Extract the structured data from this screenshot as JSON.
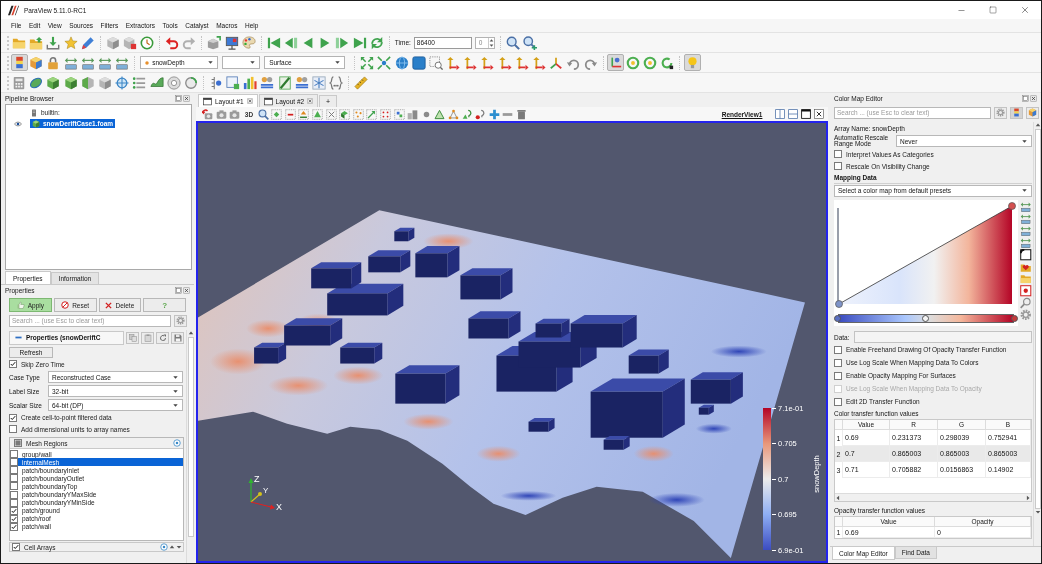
{
  "window": {
    "title": "ParaView 5.11.0-RC1"
  },
  "menu": [
    "File",
    "Edit",
    "View",
    "Sources",
    "Filters",
    "Extractors",
    "Tools",
    "Catalyst",
    "Macros",
    "Help"
  ],
  "time": {
    "label": "Time:",
    "value": "86400",
    "index": "0"
  },
  "toggles": {
    "color_bar": {
      "on": true
    },
    "axes": {
      "on": true
    },
    "lightbulb": {
      "on": true
    }
  },
  "variables": {
    "array": "snowDepth",
    "representation": "Surface"
  },
  "pipeline_browser": {
    "title": "Pipeline Browser",
    "items": [
      {
        "label": "builtin:",
        "selected": false,
        "children": [
          {
            "label": "snowDeriftCase1.foam",
            "selected": true,
            "visible": true
          }
        ]
      }
    ]
  },
  "left_tabs": [
    {
      "label": "Properties",
      "selected": true
    },
    {
      "label": "Information",
      "selected": false
    }
  ],
  "properties": {
    "title": "Properties",
    "buttons": [
      {
        "kind": "apply",
        "label": "Apply"
      },
      {
        "kind": "reset",
        "label": "Reset"
      },
      {
        "kind": "delete",
        "label": "Delete"
      },
      {
        "kind": "help",
        "label": "?"
      }
    ],
    "search": {
      "placeholder": "Search ... (use Esc to clear text)"
    },
    "section_title": "Properties (snowDeriftC",
    "refresh": "Refresh",
    "skip_zero_time": {
      "label": "Skip Zero Time",
      "checked": true
    },
    "fields": [
      {
        "label": "Case Type",
        "value": "Reconstructed Case"
      },
      {
        "label": "Label Size",
        "value": "32-bit"
      },
      {
        "label": "Scalar Size",
        "value": "64-bit (DP)"
      }
    ],
    "options": [
      {
        "label": "Create cell-to-point filtered data",
        "checked": true
      },
      {
        "label": "Add dimensional units to array names",
        "checked": false
      }
    ],
    "mesh_regions": {
      "title": "Mesh Regions",
      "checked": false,
      "partial": true,
      "items": [
        {
          "label": "group/wall",
          "checked": false,
          "selected": false
        },
        {
          "label": "internalMesh",
          "checked": false,
          "selected": true
        },
        {
          "label": "patch/boundaryInlet",
          "checked": false,
          "selected": false
        },
        {
          "label": "patch/boundaryOutlet",
          "checked": false,
          "selected": false
        },
        {
          "label": "patch/boundaryTop",
          "checked": false,
          "selected": false
        },
        {
          "label": "patch/boundaryYMaxSide",
          "checked": false,
          "selected": false
        },
        {
          "label": "patch/boundaryYMinSide",
          "checked": false,
          "selected": false
        },
        {
          "label": "patch/ground",
          "checked": true,
          "selected": false
        },
        {
          "label": "patch/roof",
          "checked": true,
          "selected": false
        },
        {
          "label": "patch/wall",
          "checked": true,
          "selected": false
        }
      ]
    },
    "cell_arrays": {
      "title": "Cell Arrays",
      "checked": true
    }
  },
  "layout_tabs": [
    {
      "label": "Layout #1",
      "selected": true
    },
    {
      "label": "Layout #2",
      "selected": false
    }
  ],
  "new_tab": "+",
  "view_toolbar": {
    "mode": "3D",
    "view_name": "RenderView1"
  },
  "render_view": {
    "axes": [
      {
        "label": "Z"
      },
      {
        "label": "Y"
      },
      {
        "label": "X"
      }
    ],
    "legend": {
      "title": "snowDepth",
      "labels": [
        "7.1e-01",
        "0.705",
        "0.7",
        "0.695",
        "6.9e-01"
      ]
    }
  },
  "color_map_editor": {
    "title": "Color Map Editor",
    "search": {
      "placeholder": "Search ... (use Esc to clear text)"
    },
    "array_name": "Array Name: snowDepth",
    "rescale": {
      "label": "Automatic Rescale Range Mode",
      "value": "Never"
    },
    "options": [
      {
        "label": "Interpret Values As Categories",
        "checked": false
      },
      {
        "label": "Rescale On Visibility Change",
        "checked": false
      }
    ],
    "mapping_title": "Mapping Data",
    "preset": "Select a color map from default presets",
    "data_label": "Data:",
    "mapping_options": [
      {
        "label": "Enable Freehand Drawing Of Opacity Transfer Function",
        "checked": false,
        "disabled": false
      },
      {
        "label": "Use Log Scale When Mapping Data To Colors",
        "checked": false,
        "disabled": false
      },
      {
        "label": "Enable Opacity Mapping For Surfaces",
        "checked": false,
        "disabled": false
      },
      {
        "label": "Use Log Scale When Mapping Data To Opacity",
        "checked": false,
        "disabled": true
      },
      {
        "label": "Edit 2D Transfer Function",
        "checked": false,
        "disabled": false
      }
    ],
    "color_table": {
      "title": "Color transfer function values",
      "columns": [
        "Value",
        "R",
        "G",
        "B"
      ],
      "rows": [
        {
          "index": "1",
          "cells": [
            "0.69",
            "0.231373",
            "0.298039",
            "0.752941"
          ]
        },
        {
          "index": "2",
          "cells": [
            "0.7",
            "0.865003",
            "0.865003",
            "0.865003"
          ]
        },
        {
          "index": "3",
          "cells": [
            "0.71",
            "0.705882",
            "0.0156863",
            "0.14902"
          ]
        }
      ]
    },
    "opacity_table": {
      "title": "Opacity transfer function values",
      "columns": [
        "Value",
        "Opacity"
      ],
      "rows": [
        {
          "index": "1",
          "cells": [
            "0.69",
            "0"
          ]
        }
      ]
    }
  },
  "right_tabs": [
    {
      "label": "Color Map Editor",
      "selected": true
    },
    {
      "label": "Find Data",
      "selected": false
    }
  ]
}
